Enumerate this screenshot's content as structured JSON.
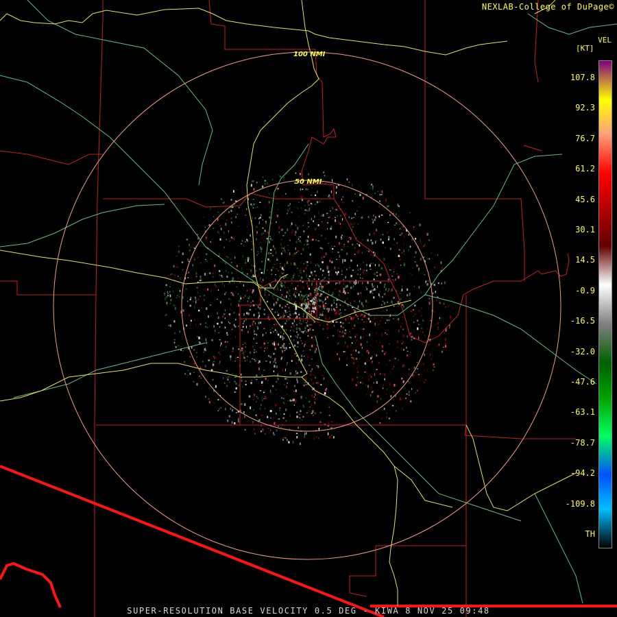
{
  "credit": "NEXLAB-College of DuPage©",
  "footer": "SUPER-RESOLUTION BASE VELOCITY 0.5 DEG - KIWA 8 NOV 25 09:48",
  "legend": {
    "variable": "VEL",
    "unit": "[KT]",
    "labels": [
      "107.8",
      "92.3",
      "76.7",
      "61.2",
      "45.6",
      "30.1",
      "14.5",
      "-0.9",
      "-16.5",
      "-32.0",
      "-47.6",
      "-63.1",
      "-78.7",
      "-94.2",
      "-109.8",
      "TH"
    ],
    "colors": [
      "#800080",
      "#ffff00",
      "#ffa07a",
      "#ff0000",
      "#b00000",
      "#600000",
      "#ffffff",
      "#808080",
      "#006000",
      "#00a000",
      "#00ff60",
      "#0050ff",
      "#00c0ff",
      "#000000"
    ]
  },
  "range_rings": {
    "inner_label": "50 NMI",
    "outer_label": "100 NMI"
  },
  "colors": {
    "background": "#000000",
    "county_lines": "#c81e1e",
    "state_border": "#ff0000",
    "highways": "#e6e650",
    "range_ring": "#f0a080",
    "rivers": "#60c080"
  }
}
